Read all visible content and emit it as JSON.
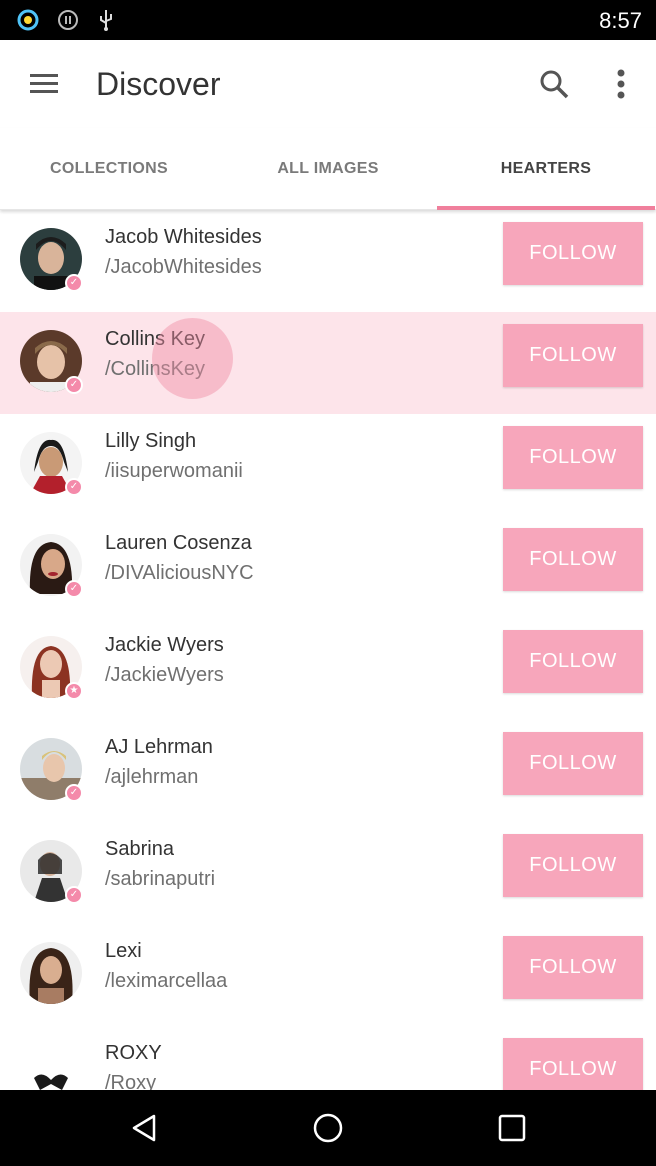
{
  "status_bar": {
    "time": "8:57",
    "icons": [
      "circle-app-icon",
      "pause-icon",
      "usb-icon"
    ]
  },
  "app_bar": {
    "title": "Discover",
    "icons": [
      "menu-icon",
      "search-icon",
      "more-vert-icon"
    ]
  },
  "tabs": [
    {
      "label": "COLLECTIONS",
      "active": false
    },
    {
      "label": "ALL IMAGES",
      "active": false
    },
    {
      "label": "HEARTERS",
      "active": true
    }
  ],
  "colors": {
    "accent": "#f07f9c",
    "follow_button": "#f7a6bb",
    "row_highlight": "#fde4ea"
  },
  "users": [
    {
      "name": "Jacob Whitesides",
      "handle": "/JacobWhitesides",
      "follow_label": "FOLLOW",
      "badge": "check"
    },
    {
      "name": "Collins Key",
      "handle": "/CollinsKey",
      "follow_label": "FOLLOW",
      "badge": "check"
    },
    {
      "name": "Lilly Singh",
      "handle": "/iisuperwomanii",
      "follow_label": "FOLLOW",
      "badge": "check"
    },
    {
      "name": "Lauren Cosenza",
      "handle": "/DIVAliciousNYC",
      "follow_label": "FOLLOW",
      "badge": "check"
    },
    {
      "name": "Jackie Wyers",
      "handle": "/JackieWyers",
      "follow_label": "FOLLOW",
      "badge": "star"
    },
    {
      "name": "AJ Lehrman",
      "handle": "/ajlehrman",
      "follow_label": "FOLLOW",
      "badge": "check"
    },
    {
      "name": "Sabrina",
      "handle": "/sabrinaputri",
      "follow_label": "FOLLOW",
      "badge": "check"
    },
    {
      "name": "Lexi",
      "handle": "/leximarcellaa",
      "follow_label": "FOLLOW",
      "badge": "none"
    },
    {
      "name": "ROXY",
      "handle": "/Roxy",
      "follow_label": "FOLLOW",
      "badge": "none"
    }
  ],
  "nav_bar": {
    "icons": [
      "back-icon",
      "home-icon",
      "recents-icon"
    ]
  }
}
